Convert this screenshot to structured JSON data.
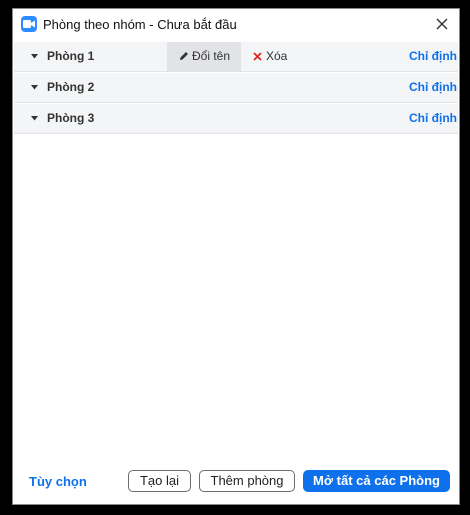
{
  "window": {
    "title": "Phòng theo nhóm - Chưa bắt đầu",
    "app_icon": "zoom-video-icon",
    "accent_color": "#0e71eb"
  },
  "rooms": [
    {
      "name": "Phòng 1",
      "assign_label": "Chỉ định",
      "rename_label": "Đổi tên",
      "delete_label": "Xóa"
    },
    {
      "name": "Phòng 2",
      "assign_label": "Chỉ định"
    },
    {
      "name": "Phòng 3",
      "assign_label": "Chỉ định"
    }
  ],
  "footer": {
    "options_label": "Tùy chọn",
    "recreate_label": "Tạo lại",
    "add_room_label": "Thêm phòng",
    "open_all_label": "Mở tất cả các Phòng"
  }
}
